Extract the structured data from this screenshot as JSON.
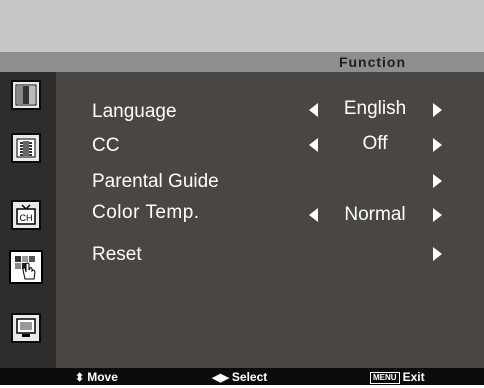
{
  "header": {
    "title": "Function"
  },
  "sidebar": {
    "icons": [
      {
        "name": "picture-icon"
      },
      {
        "name": "audio-icon"
      },
      {
        "name": "tv-channel-icon"
      },
      {
        "name": "function-icon",
        "active": true
      },
      {
        "name": "pc-icon"
      }
    ]
  },
  "menu": {
    "items": [
      {
        "label": "Language",
        "value": "English"
      },
      {
        "label": "CC",
        "value": "Off"
      },
      {
        "label": "Parental Guide",
        "value": ""
      },
      {
        "label": "Color Temp.",
        "value": "Normal"
      },
      {
        "label": "Reset",
        "value": ""
      }
    ]
  },
  "footer": {
    "move": "Move",
    "select": "Select",
    "menu_key": "MENU",
    "exit": "Exit"
  },
  "colors": {
    "panel": "#4a4643",
    "header": "#8e8e8e",
    "topbar": "#c7c7c7",
    "footer": "#0c0c0c"
  }
}
